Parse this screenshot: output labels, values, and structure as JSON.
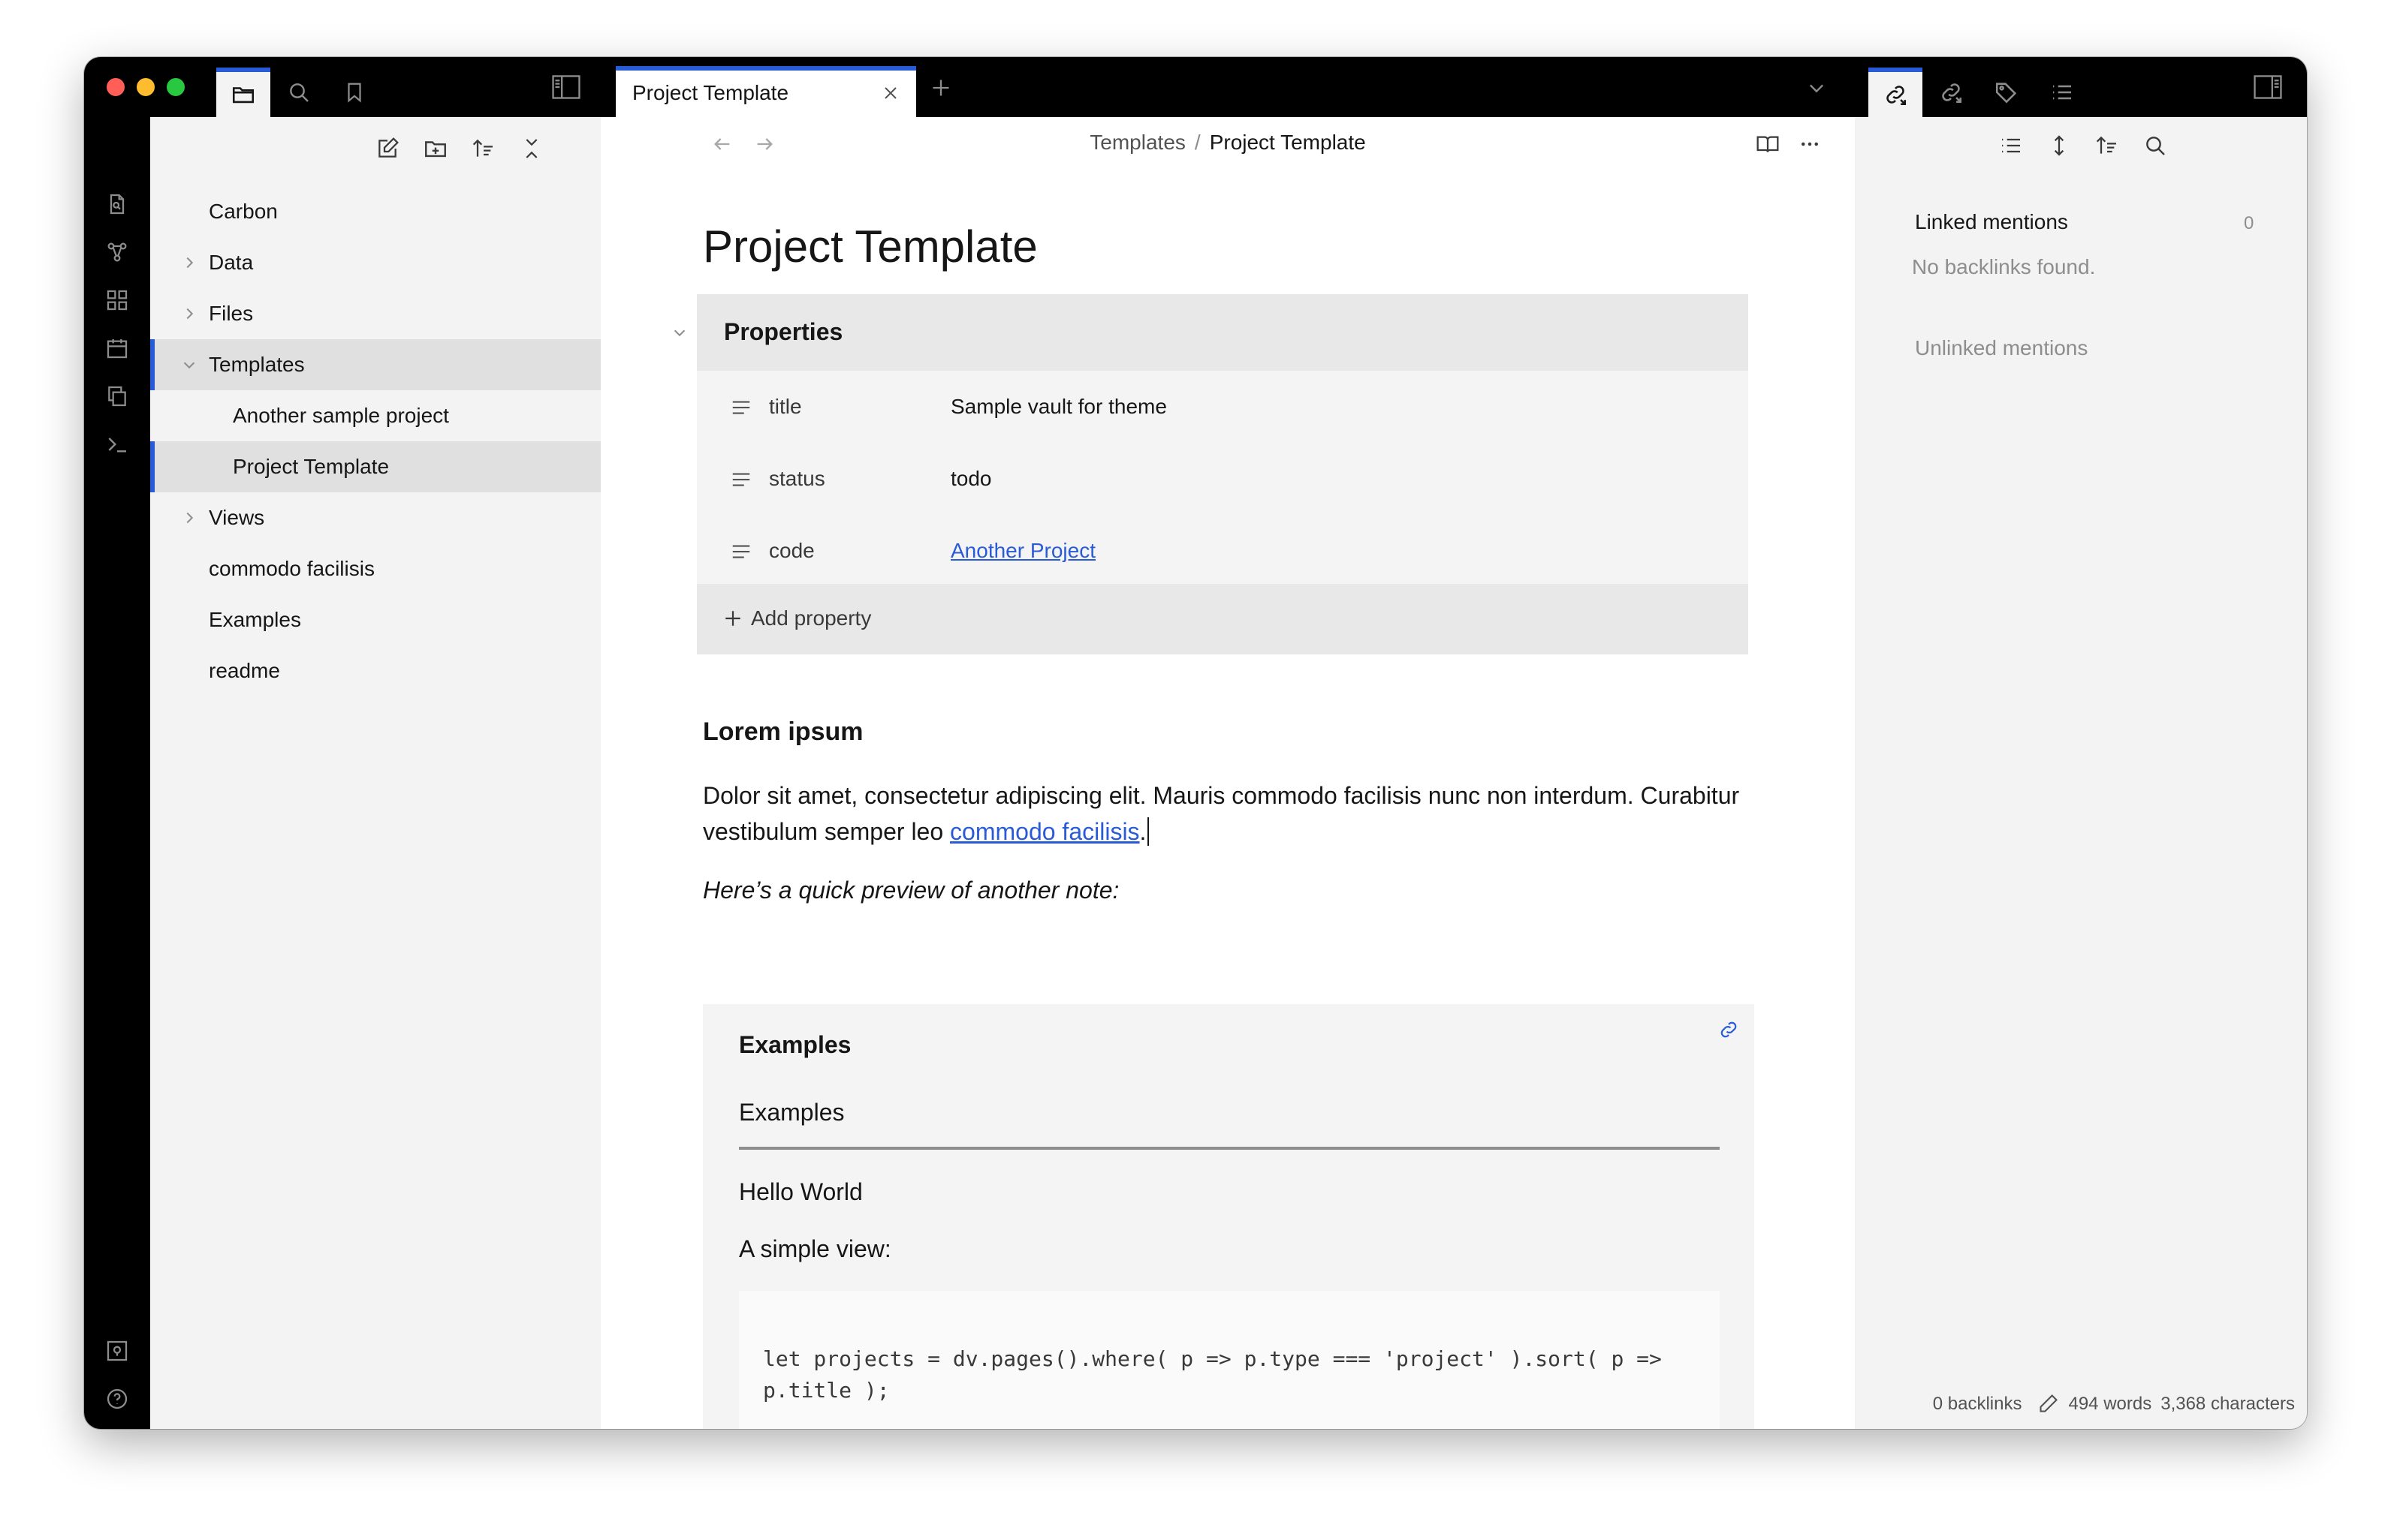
{
  "window": {
    "tabs": [
      {
        "title": "Project Template"
      }
    ],
    "left_tabs": [
      "files-icon",
      "search-icon",
      "bookmark-icon"
    ],
    "right_tabs": [
      "backlinks-icon",
      "outgoing-links-icon",
      "tags-icon",
      "outline-icon"
    ]
  },
  "sidebar": {
    "toolbar": [
      "new-note-icon",
      "new-folder-icon",
      "sort-icon",
      "collapse-all-icon"
    ],
    "root": "Carbon",
    "items": [
      {
        "label": "Data",
        "type": "folder",
        "expanded": false
      },
      {
        "label": "Files",
        "type": "folder",
        "expanded": false
      },
      {
        "label": "Templates",
        "type": "folder",
        "expanded": true
      },
      {
        "label": "Another sample project",
        "type": "file"
      },
      {
        "label": "Project Template",
        "type": "file",
        "selected": true
      },
      {
        "label": "Views",
        "type": "folder",
        "expanded": false
      },
      {
        "label": "commodo facilisis",
        "type": "file"
      },
      {
        "label": "Examples",
        "type": "file"
      },
      {
        "label": "readme",
        "type": "file"
      }
    ]
  },
  "breadcrumb": {
    "parent": "Templates",
    "separator": "/",
    "current": "Project Template"
  },
  "note": {
    "title": "Project Template",
    "properties_label": "Properties",
    "properties": [
      {
        "key": "title",
        "value": "Sample vault for theme",
        "link": false
      },
      {
        "key": "status",
        "value": "todo",
        "link": false
      },
      {
        "key": "code",
        "value": "Another Project",
        "link": true
      }
    ],
    "add_property": "Add property",
    "heading": "Lorem ipsum",
    "paragraph_text": "Dolor sit amet, consectetur adipiscing elit. Mauris commodo facilisis nunc non interdum. Curabitur vestibulum semper leo ",
    "paragraph_link": "commodo facilisis",
    "paragraph_end": ".",
    "italic": "Here’s a quick preview of another note:",
    "embed": {
      "title": "Examples",
      "heading": "Examples",
      "p1": "Hello World",
      "p2": "A simple view:",
      "code": "let projects = dv.pages().where( p => p.type === 'project' ).sort( p => p.title );\n\ndv.view( 'hello-world', projects );"
    }
  },
  "right_panel": {
    "toolbar": [
      "list-icon",
      "expand-icon",
      "sort-icon",
      "search-icon"
    ],
    "linked_title": "Linked mentions",
    "linked_count": "0",
    "linked_empty": "No backlinks found.",
    "unlinked_title": "Unlinked mentions"
  },
  "status_bar": {
    "backlinks": "0 backlinks",
    "words": "494 words",
    "characters": "3,368 characters"
  },
  "colors": {
    "accent": "#2a5bd7",
    "link": "#2a5bd7",
    "chrome": "#000000",
    "panel": "#f3f3f3"
  }
}
